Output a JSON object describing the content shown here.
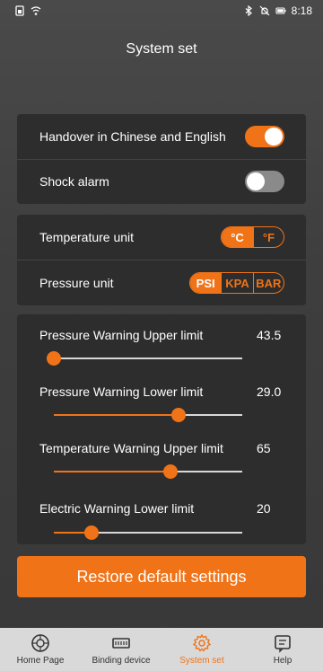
{
  "status_bar": {
    "time": "8:18"
  },
  "page": {
    "title": "System set"
  },
  "toggles": [
    {
      "label": "Handover in Chinese and English",
      "on": true
    },
    {
      "label": "Shock alarm",
      "on": false
    }
  ],
  "units": {
    "temperature": {
      "label": "Temperature unit",
      "options": [
        "°C",
        "°F"
      ],
      "selected": "°C"
    },
    "pressure": {
      "label": "Pressure unit",
      "options": [
        "PSI",
        "KPA",
        "BAR"
      ],
      "selected": "PSI"
    }
  },
  "sliders": [
    {
      "label": "Pressure Warning Upper limit",
      "value": "43.5",
      "fraction": 0.0
    },
    {
      "label": "Pressure Warning Lower limit",
      "value": "29.0",
      "fraction": 0.66
    },
    {
      "label": "Temperature Warning Upper limit",
      "value": "65",
      "fraction": 0.62
    },
    {
      "label": "Electric Warning Lower limit",
      "value": "20",
      "fraction": 0.2
    }
  ],
  "restore_button": {
    "label": "Restore default settings"
  },
  "tabs": [
    {
      "label": "Home Page",
      "icon": "tire-icon",
      "active": false
    },
    {
      "label": "Binding device",
      "icon": "device-icon",
      "active": false
    },
    {
      "label": "System set",
      "icon": "gear-icon",
      "active": true
    },
    {
      "label": "Help",
      "icon": "help-icon",
      "active": false
    }
  ],
  "colors": {
    "accent": "#f07318",
    "card": "#2d2d2d",
    "tabbar": "#d9d9d9"
  }
}
